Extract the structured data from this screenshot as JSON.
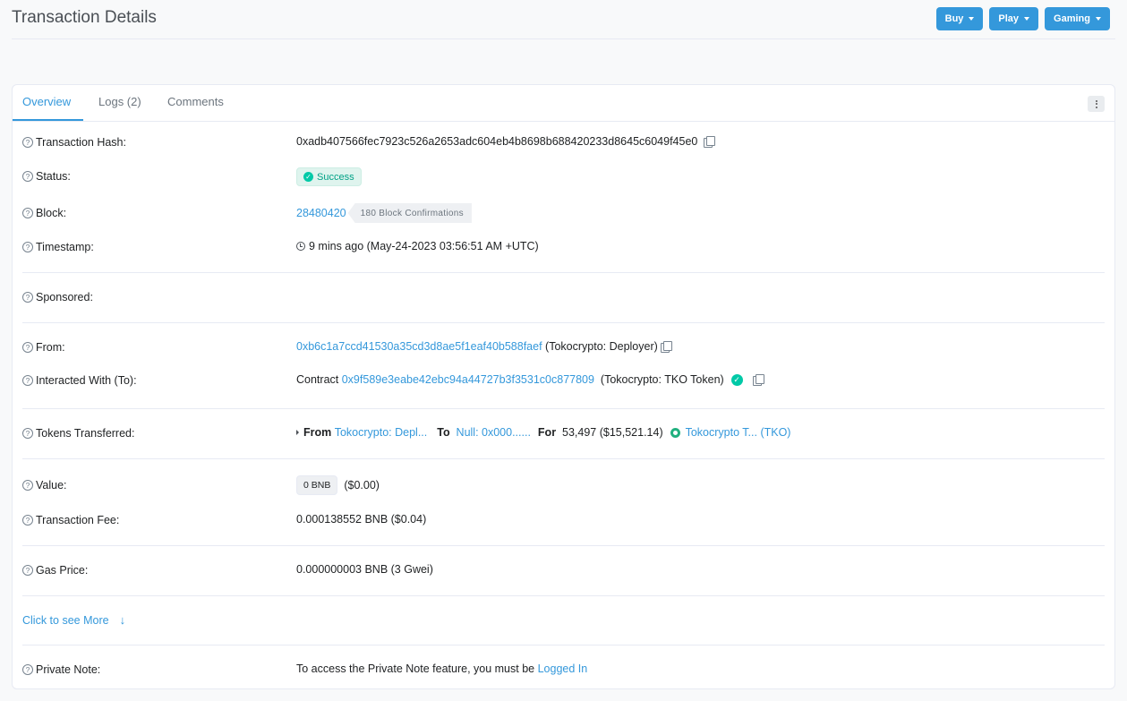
{
  "header": {
    "title": "Transaction Details",
    "buttons": [
      {
        "label": "Buy"
      },
      {
        "label": "Play"
      },
      {
        "label": "Gaming"
      }
    ]
  },
  "tabs": [
    {
      "label": "Overview",
      "active": true
    },
    {
      "label": "Logs (2)",
      "active": false
    },
    {
      "label": "Comments",
      "active": false
    }
  ],
  "details": {
    "tx_hash": {
      "label": "Transaction Hash:",
      "value": "0xadb407566fec7923c526a2653adc604eb4b8698b688420233d8645c6049f45e0"
    },
    "status": {
      "label": "Status:",
      "value": "Success"
    },
    "block": {
      "label": "Block:",
      "value": "28480420",
      "confirmations": "180 Block Confirmations"
    },
    "timestamp": {
      "label": "Timestamp:",
      "value": "9 mins ago (May-24-2023 03:56:51 AM +UTC)"
    },
    "sponsored": {
      "label": "Sponsored:"
    },
    "from": {
      "label": "From:",
      "address": "0xb6c1a7ccd41530a35cd3d8ae5f1eaf40b588faef",
      "name": "(Tokocrypto: Deployer)"
    },
    "to": {
      "label": "Interacted With (To):",
      "prefix": "Contract",
      "address": "0x9f589e3eabe42ebc94a44727b3f3531c0c877809",
      "name": "(Tokocrypto: TKO Token)"
    },
    "tokens": {
      "label": "Tokens Transferred:",
      "from_label": "From",
      "from_value": "Tokocrypto: Depl...",
      "to_label": "To",
      "to_value": "Null: 0x000......",
      "for_label": "For",
      "amount": "53,497 ($15,521.14)",
      "token": "Tokocrypto T... (TKO)"
    },
    "value": {
      "label": "Value:",
      "badge": "0 BNB",
      "usd": "($0.00)"
    },
    "fee": {
      "label": "Transaction Fee:",
      "value": "0.000138552 BNB ($0.04)"
    },
    "gas": {
      "label": "Gas Price:",
      "value": "0.000000003 BNB (3 Gwei)"
    },
    "see_more": "Click to see More",
    "private_note": {
      "label": "Private Note:",
      "text": "To access the Private Note feature, you must be ",
      "link": "Logged In"
    }
  },
  "colors": {
    "accent": "#3498db",
    "success": "#00c9a7"
  }
}
